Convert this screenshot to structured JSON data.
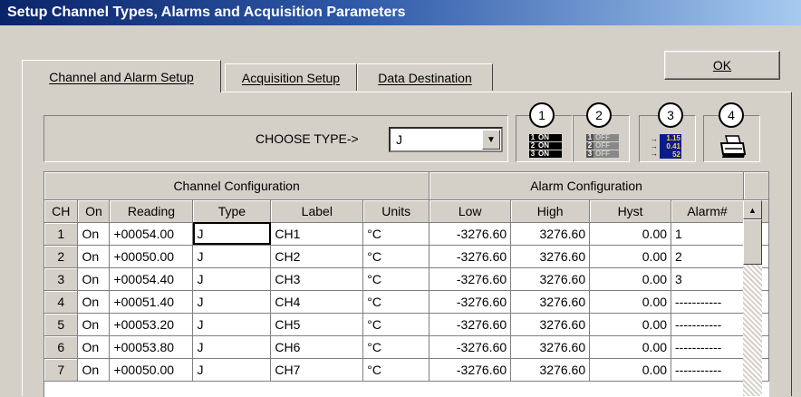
{
  "window": {
    "title": "Setup Channel Types, Alarms and Acquisition Parameters"
  },
  "buttons": {
    "ok": "OK"
  },
  "tabs": [
    {
      "label": "Channel and Alarm Setup"
    },
    {
      "label": "Acquisition Setup"
    },
    {
      "label": "Data Destination"
    }
  ],
  "type_bar": {
    "label": "CHOOSE TYPE->",
    "selected": "J"
  },
  "toolbar": [
    {
      "number": "1",
      "icon": "all-channels-on-icon",
      "lines": [
        "ON",
        "ON",
        "ON"
      ]
    },
    {
      "number": "2",
      "icon": "all-channels-off-icon",
      "lines": [
        "OFF",
        "OFF",
        "OFF"
      ]
    },
    {
      "number": "3",
      "icon": "readings-display-icon",
      "lines": [
        "1.15",
        "0.41",
        "52"
      ]
    },
    {
      "number": "4",
      "icon": "printer-icon"
    }
  ],
  "grid": {
    "group_headers": {
      "channel": "Channel Configuration",
      "alarm": "Alarm Configuration"
    },
    "columns": [
      "CH",
      "On",
      "Reading",
      "Type",
      "Label",
      "Units",
      "Low",
      "High",
      "Hyst",
      "Alarm#"
    ],
    "rows": [
      [
        "1",
        "On",
        "+00054.00",
        "J",
        "CH1",
        "°C",
        "-3276.60",
        "3276.60",
        "0.00",
        "1"
      ],
      [
        "2",
        "On",
        "+00050.00",
        "J",
        "CH2",
        "°C",
        "-3276.60",
        "3276.60",
        "0.00",
        "2"
      ],
      [
        "3",
        "On",
        "+00054.40",
        "J",
        "CH3",
        "°C",
        "-3276.60",
        "3276.60",
        "0.00",
        "3"
      ],
      [
        "4",
        "On",
        "+00051.40",
        "J",
        "CH4",
        "°C",
        "-3276.60",
        "3276.60",
        "0.00",
        "-----------"
      ],
      [
        "5",
        "On",
        "+00053.20",
        "J",
        "CH5",
        "°C",
        "-3276.60",
        "3276.60",
        "0.00",
        "-----------"
      ],
      [
        "6",
        "On",
        "+00053.80",
        "J",
        "CH6",
        "°C",
        "-3276.60",
        "3276.60",
        "0.00",
        "-----------"
      ],
      [
        "7",
        "On",
        "+00050.00",
        "J",
        "CH7",
        "°C",
        "-3276.60",
        "3276.60",
        "0.00",
        "-----------"
      ]
    ]
  }
}
